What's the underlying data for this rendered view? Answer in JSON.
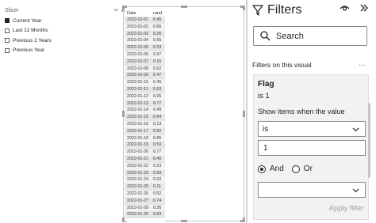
{
  "slicer": {
    "title": "Slicer",
    "items": [
      {
        "label": "Current Year",
        "checked": true
      },
      {
        "label": "Last 12 Months",
        "checked": false
      },
      {
        "label": "Previous 2 Years",
        "checked": false
      },
      {
        "label": "Previous Year",
        "checked": false
      }
    ]
  },
  "table": {
    "headers": {
      "date": "Date",
      "rand": "rand"
    },
    "rows": [
      {
        "date": "2022-01-01",
        "rand": "0.45"
      },
      {
        "date": "2022-01-02",
        "rand": "0.66"
      },
      {
        "date": "2022-01-03",
        "rand": "0.26"
      },
      {
        "date": "2022-01-04",
        "rand": "0.65"
      },
      {
        "date": "2022-01-05",
        "rand": "0.53"
      },
      {
        "date": "2022-01-06",
        "rand": "0.97"
      },
      {
        "date": "2022-01-07",
        "rand": "0.16"
      },
      {
        "date": "2022-01-08",
        "rand": "0.62"
      },
      {
        "date": "2022-01-09",
        "rand": "0.47"
      },
      {
        "date": "2022-01-10",
        "rand": "0.45"
      },
      {
        "date": "2022-01-11",
        "rand": "0.63"
      },
      {
        "date": "2022-01-12",
        "rand": "0.05"
      },
      {
        "date": "2022-01-13",
        "rand": "0.77"
      },
      {
        "date": "2022-01-14",
        "rand": "0.49"
      },
      {
        "date": "2022-01-15",
        "rand": "0.64"
      },
      {
        "date": "2022-01-16",
        "rand": "0.13"
      },
      {
        "date": "2022-01-17",
        "rand": "0.50"
      },
      {
        "date": "2022-01-18",
        "rand": "0.85"
      },
      {
        "date": "2022-01-19",
        "rand": "0.50"
      },
      {
        "date": "2022-01-20",
        "rand": "0.77"
      },
      {
        "date": "2022-01-21",
        "rand": "0.40"
      },
      {
        "date": "2022-01-22",
        "rand": "0.23"
      },
      {
        "date": "2022-01-23",
        "rand": "0.59"
      },
      {
        "date": "2022-01-24",
        "rand": "0.02"
      },
      {
        "date": "2022-01-25",
        "rand": "0.11"
      },
      {
        "date": "2022-01-26",
        "rand": "0.52"
      },
      {
        "date": "2022-01-27",
        "rand": "0.74"
      },
      {
        "date": "2022-01-28",
        "rand": "0.36"
      },
      {
        "date": "2022-01-29",
        "rand": "0.83"
      }
    ]
  },
  "filters": {
    "title": "Filters",
    "search_label": "Search",
    "section_label": "Filters on this visual",
    "more_label": "...",
    "card": {
      "field": "Flag",
      "summary": "is 1",
      "show_label": "Show items when the value",
      "operator": "is",
      "value": "1",
      "and_label": "And",
      "or_label": "Or",
      "apply_label": "Apply filter"
    }
  },
  "icons": {
    "funnel": "funnel-icon",
    "eye": "eye-icon",
    "collapse": "double-chevron-right-icon",
    "search": "search-icon",
    "chevron": "chevron-down-icon"
  }
}
